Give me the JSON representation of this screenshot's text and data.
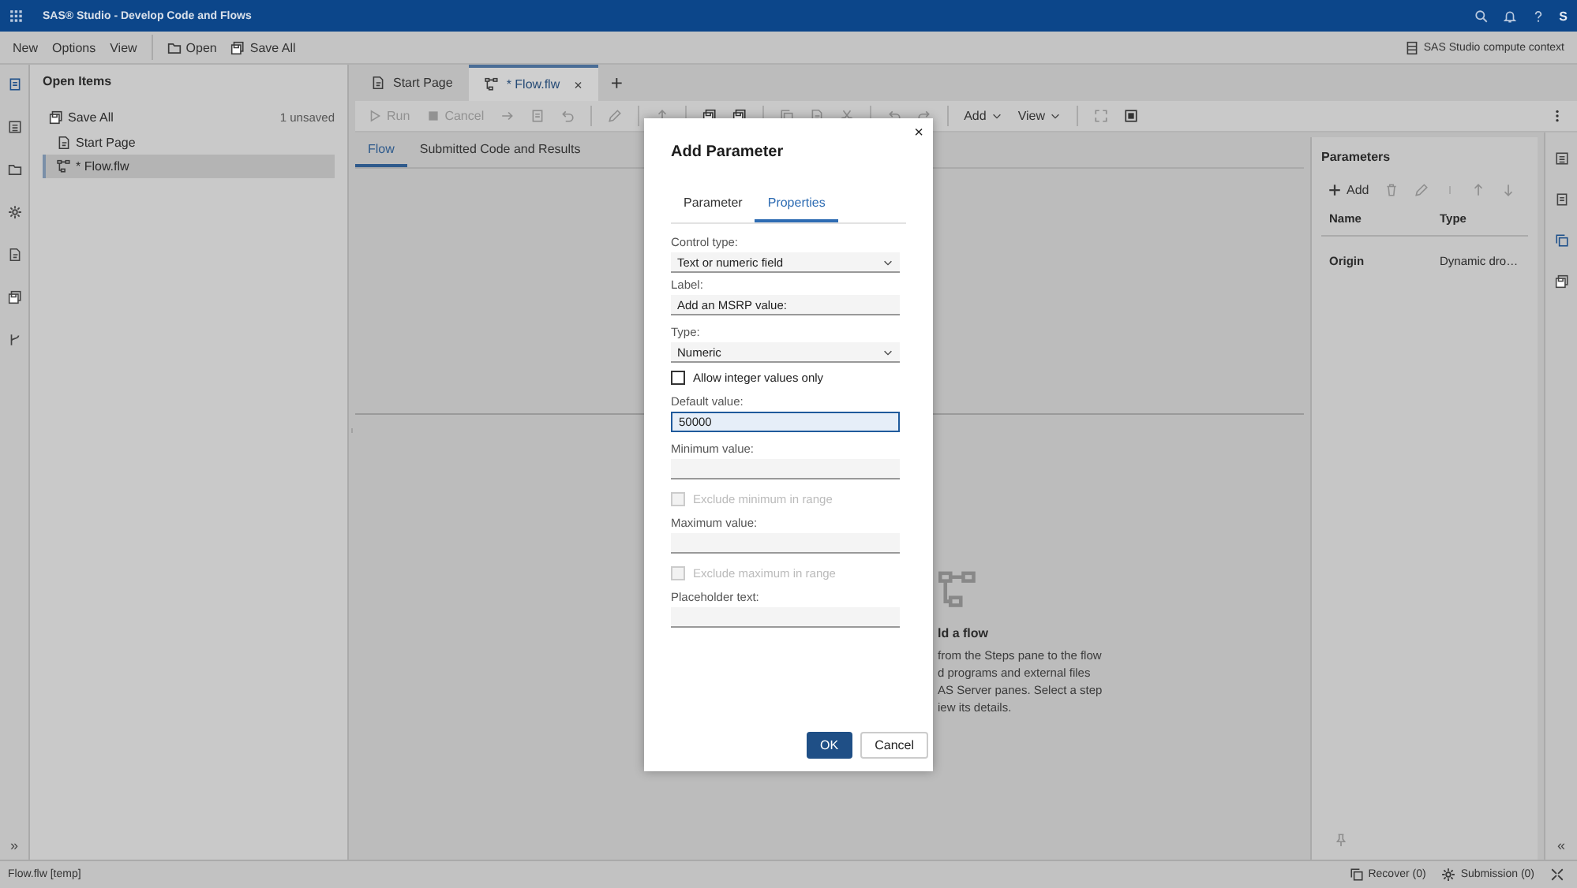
{
  "window": {
    "title": "SAS® Studio - Develop Code and Flows",
    "user_initial": "S"
  },
  "menu": {
    "items": [
      {
        "label": "New",
        "kind": "text"
      },
      {
        "label": "Options",
        "kind": "text"
      },
      {
        "label": "View",
        "kind": "text"
      },
      {
        "label": "Open",
        "kind": "folder"
      },
      {
        "label": "Save All",
        "kind": "save"
      }
    ],
    "context": "SAS Studio compute context"
  },
  "open_items": {
    "title": "Open Items",
    "save_all": "Save All",
    "unsaved": "1 unsaved",
    "items": [
      {
        "label": "Start Page",
        "kind": "page",
        "selected": false
      },
      {
        "label": "* Flow.flw",
        "kind": "flow",
        "selected": true
      }
    ]
  },
  "tabs": [
    {
      "label": "Start Page",
      "kind": "page",
      "selected": false
    },
    {
      "label": "* Flow.flw",
      "kind": "flow",
      "selected": true,
      "close": "×"
    }
  ],
  "add_tab": "+",
  "toolbar": {
    "run": "Run",
    "cancel": "Cancel",
    "add": "Add",
    "view": "View"
  },
  "subtabs": [
    {
      "label": "Flow",
      "selected": true
    },
    {
      "label": "Submitted Code and Results",
      "selected": false
    }
  ],
  "empty_state": {
    "title": "ld a flow",
    "lines": [
      "from the Steps pane to the flow",
      "d programs and external files",
      "AS Server panes. Select a step",
      "iew its details."
    ]
  },
  "parameters": {
    "title": "Parameters",
    "add": "Add",
    "columns": [
      "Name",
      "Type"
    ],
    "rows": [
      {
        "name": "Origin",
        "type": "Dynamic dro…"
      }
    ]
  },
  "left_expand": "»",
  "right_collapse": "«",
  "dialog": {
    "title": "Add Parameter",
    "close": "×",
    "tabs": [
      {
        "label": "Parameter",
        "selected": false
      },
      {
        "label": "Properties",
        "selected": true
      }
    ],
    "fields": [
      {
        "kind": "select",
        "label": "Control type:",
        "value": "Text or numeric field"
      },
      {
        "kind": "input",
        "label": "Label:",
        "value": "Add an MSRP value:",
        "focused": false
      },
      {
        "kind": "select",
        "label": "Type:",
        "value": "Numeric"
      },
      {
        "kind": "checkbox",
        "label": "Allow integer values only",
        "checked": false,
        "disabled": false
      },
      {
        "kind": "input",
        "label": "Default value:",
        "value": "50000",
        "focused": true
      },
      {
        "kind": "input",
        "label": "Minimum value:",
        "focused": false
      },
      {
        "kind": "checkbox",
        "label": "Exclude minimum in range",
        "checked": false,
        "disabled": true
      },
      {
        "kind": "input",
        "label": "Maximum value:",
        "focused": false
      },
      {
        "kind": "checkbox",
        "label": "Exclude maximum in range",
        "checked": false,
        "disabled": true
      },
      {
        "kind": "input",
        "label": "Placeholder text:",
        "focused": false
      }
    ],
    "buttons": [
      {
        "label": "OK",
        "kind": "primary"
      },
      {
        "label": "Cancel",
        "kind": "secondary"
      }
    ]
  },
  "status_bar": {
    "file": "Flow.flw [temp]",
    "recover": "Recover (0)",
    "submission": "Submission (0)"
  }
}
